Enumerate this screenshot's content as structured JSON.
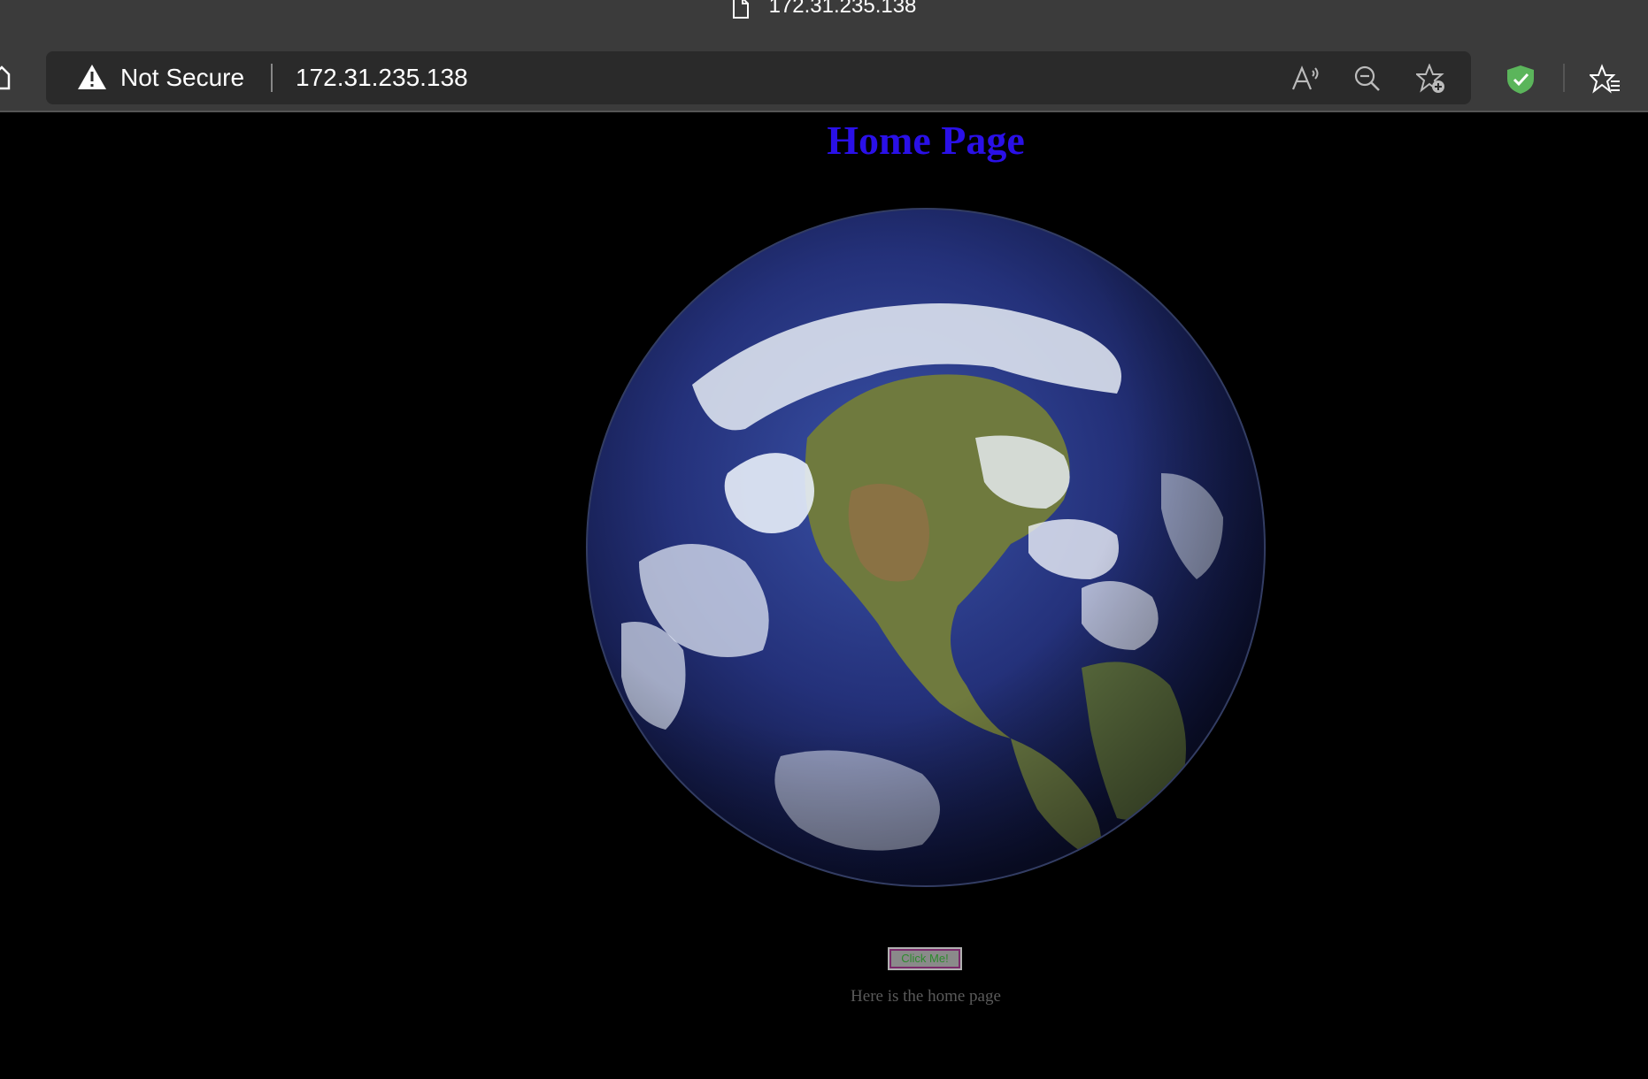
{
  "browser": {
    "tab_title": "172.31.235.138",
    "security_label": "Not Secure",
    "url": "172.31.235.138",
    "icons": {
      "tab": "document-icon",
      "home": "home-icon",
      "security": "warning-icon",
      "read_aloud": "read-aloud-icon",
      "zoom": "zoom-out-icon",
      "favorite": "add-favorite-icon",
      "shield": "shield-check-icon",
      "favorites_list": "favorites-icon"
    },
    "colors": {
      "chrome": "#3b3b3b",
      "address_bar": "#2a2a2a",
      "shield": "#5bb55b"
    }
  },
  "page": {
    "title": "Home Page",
    "title_color": "#2a10e8",
    "image": "earth-globe",
    "button_label": "Click Me!",
    "body_text": "Here is the home page"
  }
}
